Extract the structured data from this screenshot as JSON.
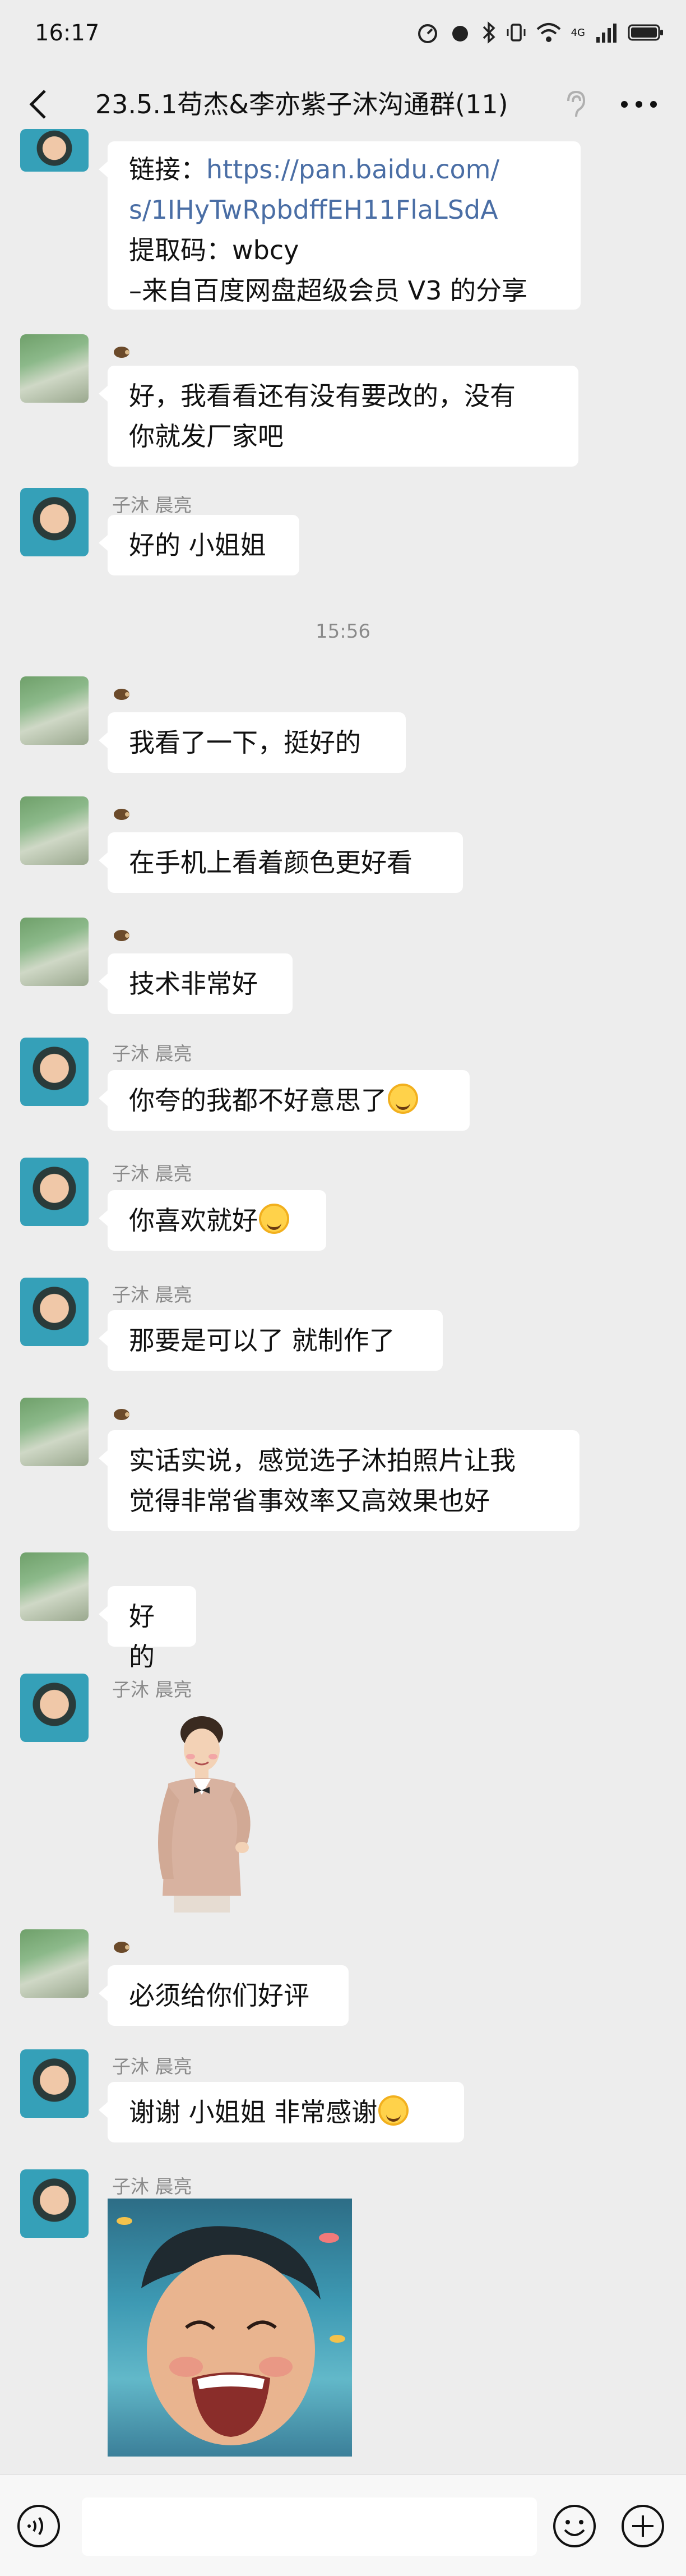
{
  "status_bar": {
    "time": "16:17",
    "network": "4G"
  },
  "header": {
    "title": "23.5.1苟杰&李亦紫子沐沟通群(11)"
  },
  "messages": [
    {
      "lines": [
        "链接：https://pan.baidu.com/",
        "s/1IHyTwRpbdffEH11FlaLSdA",
        "提取码：wbcy",
        "–来自百度网盘超级会员 V3 的分享"
      ]
    },
    {
      "lines": [
        "好，我看看还有没有要改的，没有",
        "你就发厂家吧"
      ]
    },
    {
      "sender": "子沐 晨亮",
      "text": "好的 小姐姐"
    },
    {
      "timestamp": "15:56"
    },
    {
      "text": "我看了一下，挺好的"
    },
    {
      "text": "在手机上看着颜色更好看"
    },
    {
      "text": "技术非常好"
    },
    {
      "sender": "子沐 晨亮",
      "text": "你夸的我都不好意思了"
    },
    {
      "sender": "子沐 晨亮",
      "text": "你喜欢就好"
    },
    {
      "sender": "子沐 晨亮",
      "text": "那要是可以了 就制作了"
    },
    {
      "lines": [
        "实话实说，感觉选子沐拍照片让我",
        "觉得非常省事效率又高效果也好"
      ]
    },
    {
      "text": "好的"
    },
    {
      "sender": "子沐 晨亮",
      "sticker": "sticker-man-waving"
    },
    {
      "text": "必须给你们好评"
    },
    {
      "sender": "子沐 晨亮",
      "text": "谢谢  小姐姐 非常感谢"
    },
    {
      "sender": "子沐 晨亮",
      "image": "photo-laughing-boy"
    }
  ],
  "link_prefix": "链接：",
  "link_url_line1": "https://pan.baidu.com/",
  "link_url_line2": "s/1IHyTwRpbdffEH11FlaLSdA",
  "colors": {
    "background": "#ededed",
    "bubble": "#ffffff",
    "link": "#4a6ea5",
    "meta_text": "#8a8a8a"
  }
}
